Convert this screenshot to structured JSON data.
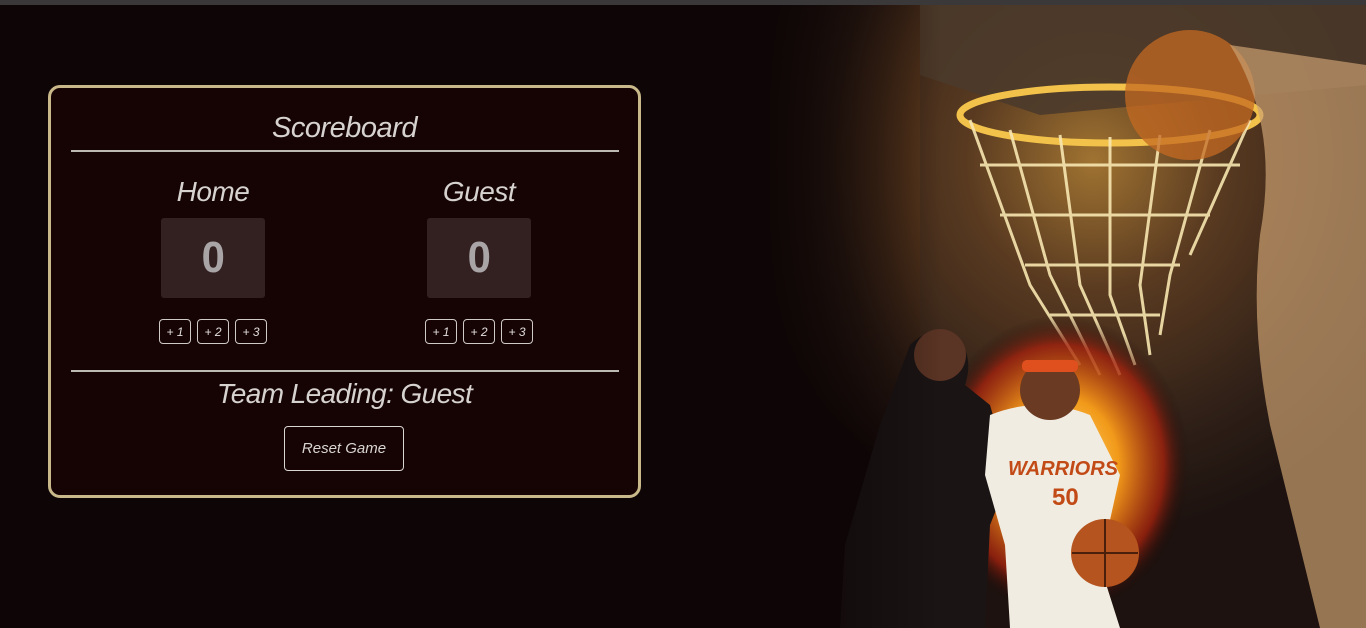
{
  "scoreboard": {
    "title": "Scoreboard",
    "home": {
      "name": "Home",
      "score": "0",
      "buttons": [
        "+ 1",
        "+ 2",
        "+ 3"
      ]
    },
    "guest": {
      "name": "Guest",
      "score": "0",
      "buttons": [
        "+ 1",
        "+ 2",
        "+ 3"
      ]
    },
    "leading_text": "Team Leading: Guest",
    "reset_label": "Reset Game"
  },
  "hero": {
    "jersey_text": "WARRIORS",
    "jersey_number": "50"
  },
  "colors": {
    "page_bg": "#0e0606",
    "board_bg": "#160404",
    "board_border": "#c9b98a",
    "score_box": "#332021",
    "text": "#d6d2d0"
  }
}
